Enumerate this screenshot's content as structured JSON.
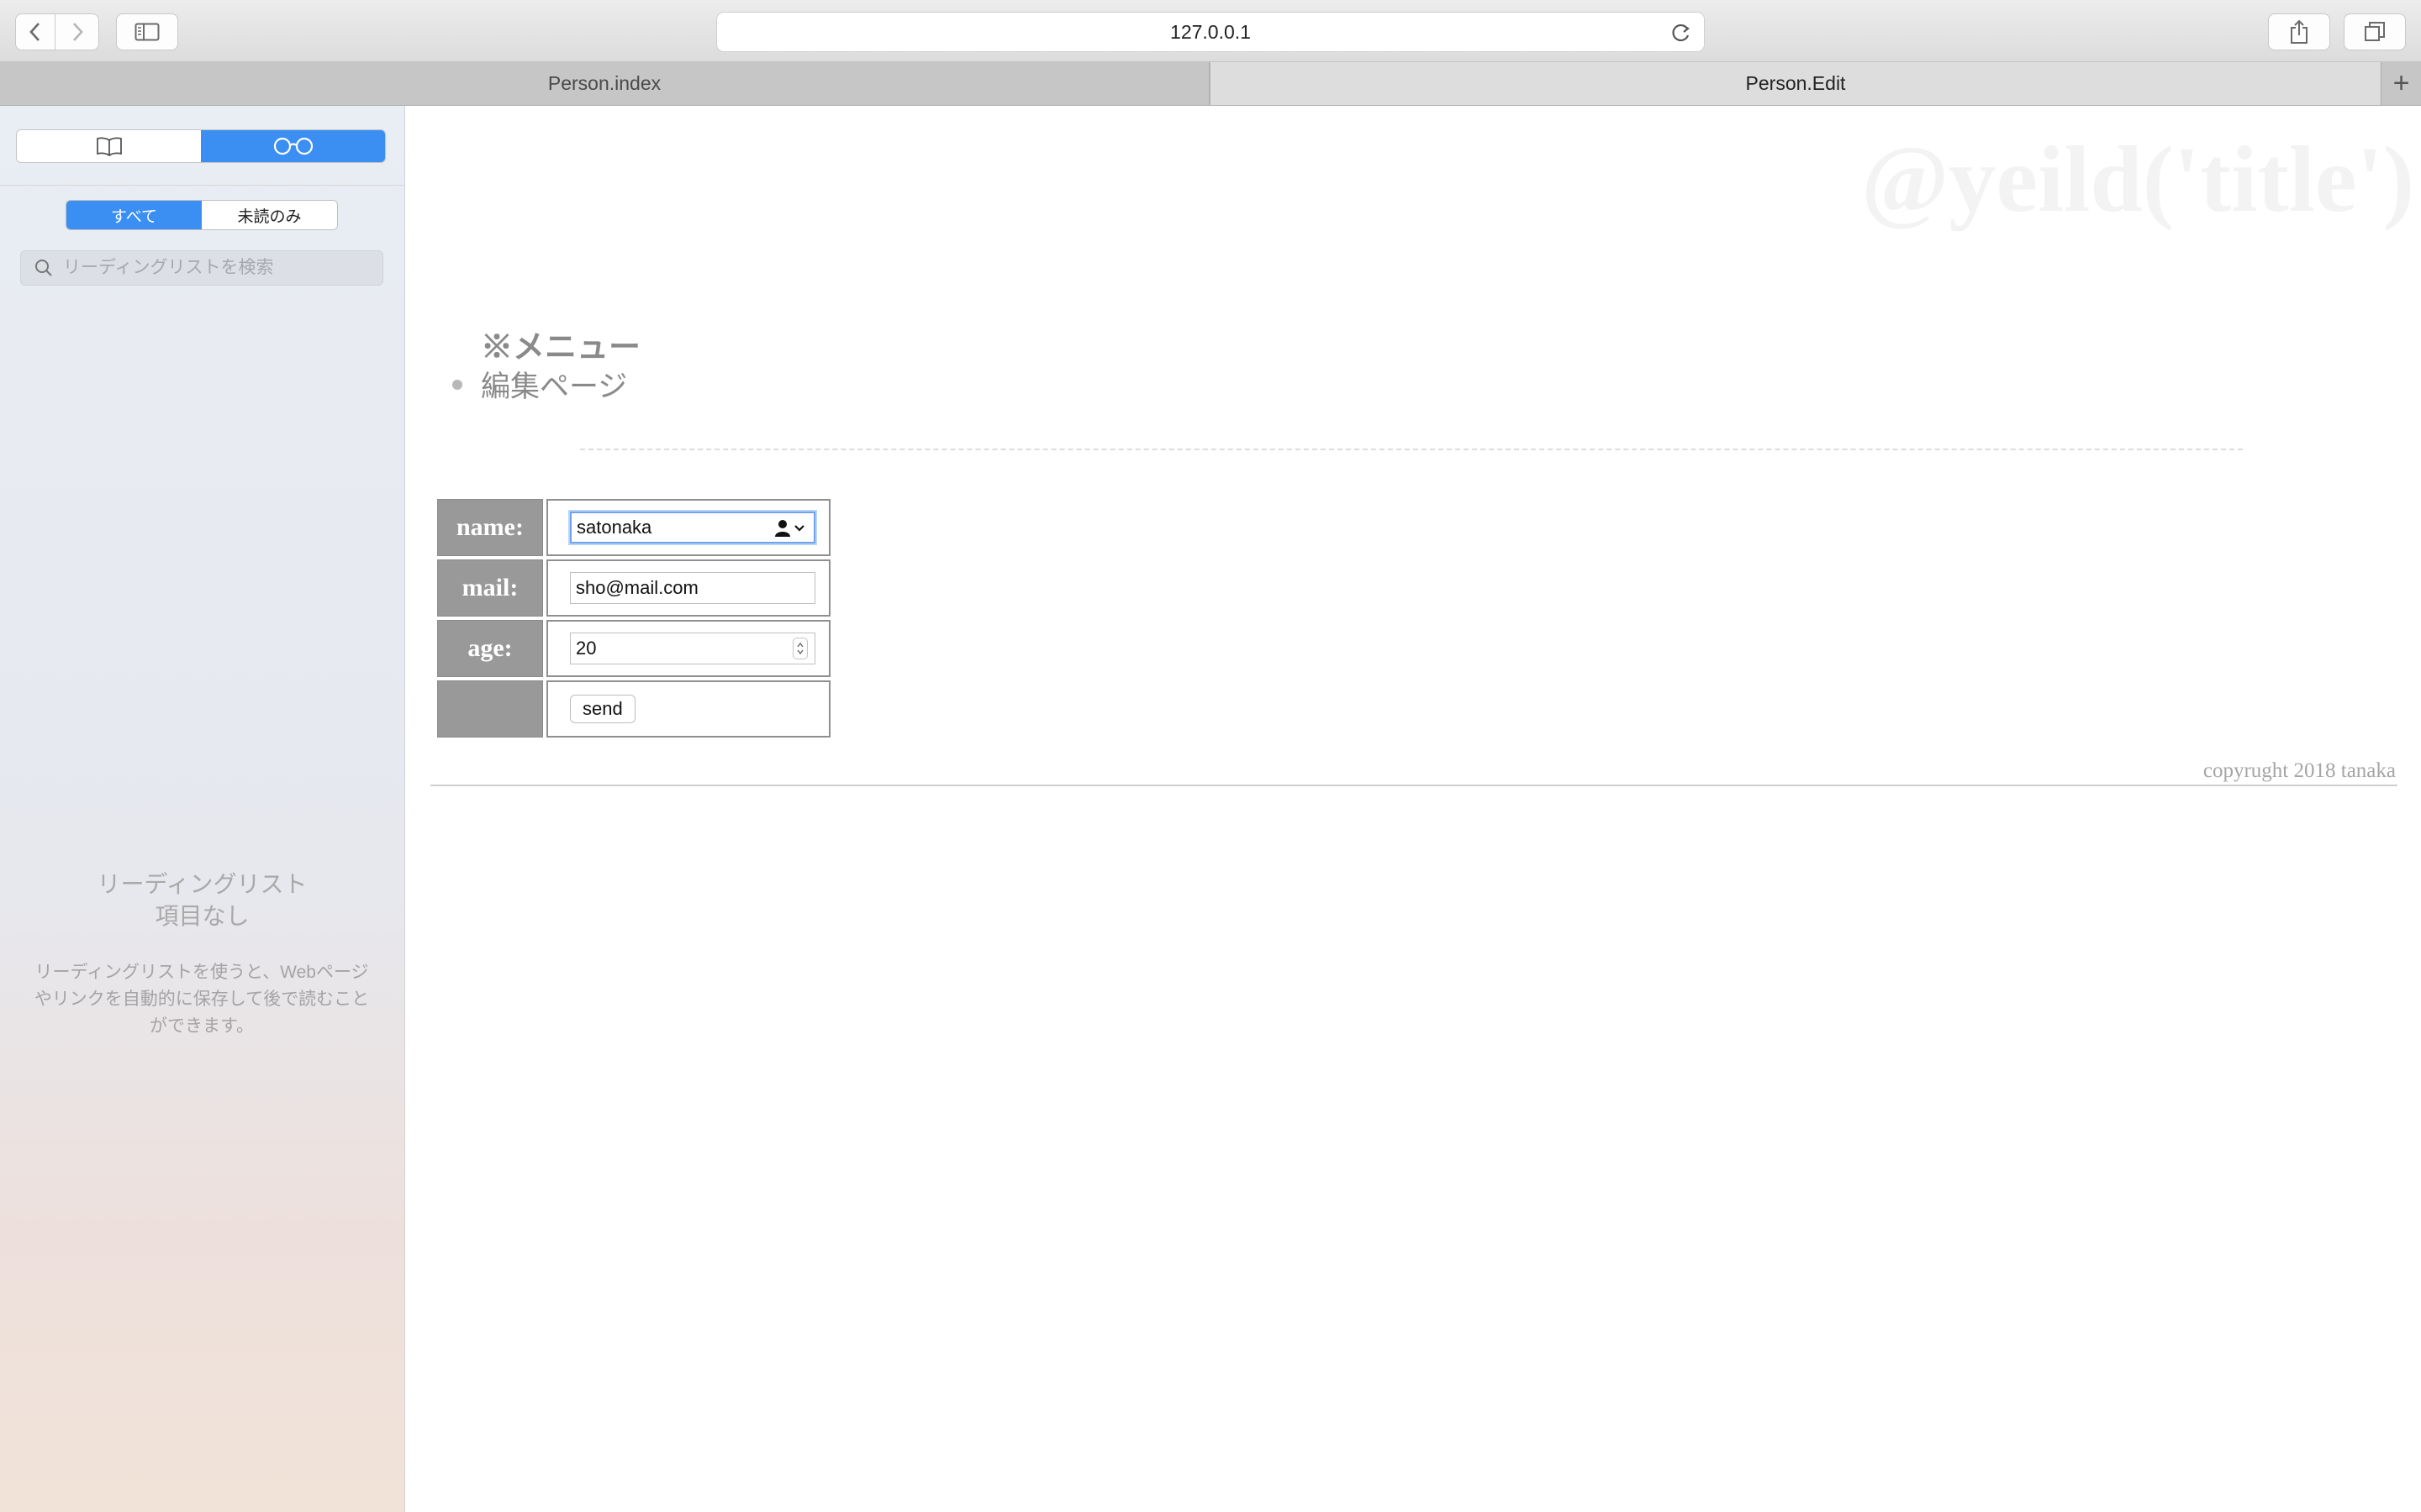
{
  "browser": {
    "address": "127.0.0.1",
    "tabs": [
      {
        "label": "Person.index",
        "active": false
      },
      {
        "label": "Person.Edit",
        "active": true
      }
    ],
    "new_tab_label": "+"
  },
  "sidebar": {
    "segments": [
      "bookmarks-icon",
      "reading-list-icon"
    ],
    "active_segment": "reading-list-icon",
    "filters": {
      "all": "すべて",
      "unread": "未読のみ",
      "selected": "all"
    },
    "search_placeholder": "リーディングリストを検索",
    "empty_title_line1": "リーディングリスト",
    "empty_title_line2": "項目なし",
    "empty_description": "リーディングリストを使うと、Webページやリンクを自動的に保存して後で読むことができます。",
    "accent_color": "#3b8ff2"
  },
  "page": {
    "watermark": "@yeild('title')",
    "menu_heading": "※メニュー",
    "menu_items": [
      "編集ページ"
    ],
    "form": {
      "name_label": "name:",
      "name_value": "satonaka",
      "mail_label": "mail:",
      "mail_value": "sho@mail.com",
      "age_label": "age:",
      "age_value": "20",
      "submit_label": "send"
    },
    "copyright": "copyrught 2018 tanaka"
  }
}
